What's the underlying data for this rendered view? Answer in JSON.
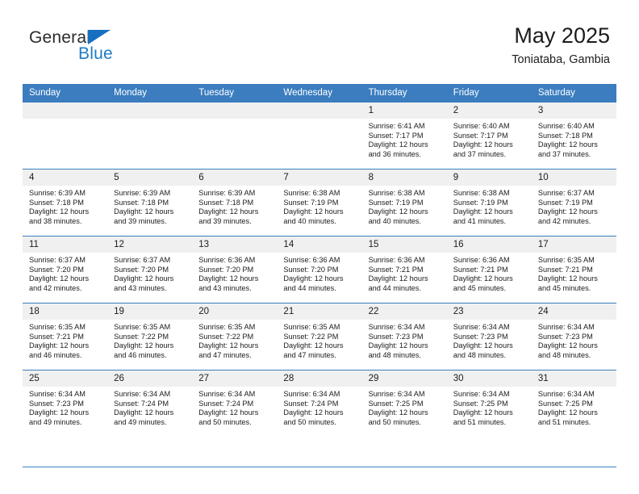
{
  "logo": {
    "word_top": "General",
    "word_bottom": "Blue",
    "triangle_icon": "triangle-icon",
    "accent_color": "#176fc1"
  },
  "header": {
    "title": "May 2025",
    "subtitle": "Toniataba, Gambia"
  },
  "theme": {
    "header_blue": "#3b7dbf",
    "daynum_bg": "#f0f0f0",
    "text": "#1c1c1c"
  },
  "weekday_headers": [
    "Sunday",
    "Monday",
    "Tuesday",
    "Wednesday",
    "Thursday",
    "Friday",
    "Saturday"
  ],
  "weeks": [
    [
      {
        "day": "",
        "empty": true,
        "sunrise": "",
        "sunset": "",
        "daylight_line1": "",
        "daylight_line2": ""
      },
      {
        "day": "",
        "empty": true,
        "sunrise": "",
        "sunset": "",
        "daylight_line1": "",
        "daylight_line2": ""
      },
      {
        "day": "",
        "empty": true,
        "sunrise": "",
        "sunset": "",
        "daylight_line1": "",
        "daylight_line2": ""
      },
      {
        "day": "",
        "empty": true,
        "sunrise": "",
        "sunset": "",
        "daylight_line1": "",
        "daylight_line2": ""
      },
      {
        "day": "1",
        "sunrise": "Sunrise: 6:41 AM",
        "sunset": "Sunset: 7:17 PM",
        "daylight_line1": "Daylight: 12 hours",
        "daylight_line2": "and 36 minutes."
      },
      {
        "day": "2",
        "sunrise": "Sunrise: 6:40 AM",
        "sunset": "Sunset: 7:17 PM",
        "daylight_line1": "Daylight: 12 hours",
        "daylight_line2": "and 37 minutes."
      },
      {
        "day": "3",
        "sunrise": "Sunrise: 6:40 AM",
        "sunset": "Sunset: 7:18 PM",
        "daylight_line1": "Daylight: 12 hours",
        "daylight_line2": "and 37 minutes."
      }
    ],
    [
      {
        "day": "4",
        "sunrise": "Sunrise: 6:39 AM",
        "sunset": "Sunset: 7:18 PM",
        "daylight_line1": "Daylight: 12 hours",
        "daylight_line2": "and 38 minutes."
      },
      {
        "day": "5",
        "sunrise": "Sunrise: 6:39 AM",
        "sunset": "Sunset: 7:18 PM",
        "daylight_line1": "Daylight: 12 hours",
        "daylight_line2": "and 39 minutes."
      },
      {
        "day": "6",
        "sunrise": "Sunrise: 6:39 AM",
        "sunset": "Sunset: 7:18 PM",
        "daylight_line1": "Daylight: 12 hours",
        "daylight_line2": "and 39 minutes."
      },
      {
        "day": "7",
        "sunrise": "Sunrise: 6:38 AM",
        "sunset": "Sunset: 7:19 PM",
        "daylight_line1": "Daylight: 12 hours",
        "daylight_line2": "and 40 minutes."
      },
      {
        "day": "8",
        "sunrise": "Sunrise: 6:38 AM",
        "sunset": "Sunset: 7:19 PM",
        "daylight_line1": "Daylight: 12 hours",
        "daylight_line2": "and 40 minutes."
      },
      {
        "day": "9",
        "sunrise": "Sunrise: 6:38 AM",
        "sunset": "Sunset: 7:19 PM",
        "daylight_line1": "Daylight: 12 hours",
        "daylight_line2": "and 41 minutes."
      },
      {
        "day": "10",
        "sunrise": "Sunrise: 6:37 AM",
        "sunset": "Sunset: 7:19 PM",
        "daylight_line1": "Daylight: 12 hours",
        "daylight_line2": "and 42 minutes."
      }
    ],
    [
      {
        "day": "11",
        "sunrise": "Sunrise: 6:37 AM",
        "sunset": "Sunset: 7:20 PM",
        "daylight_line1": "Daylight: 12 hours",
        "daylight_line2": "and 42 minutes."
      },
      {
        "day": "12",
        "sunrise": "Sunrise: 6:37 AM",
        "sunset": "Sunset: 7:20 PM",
        "daylight_line1": "Daylight: 12 hours",
        "daylight_line2": "and 43 minutes."
      },
      {
        "day": "13",
        "sunrise": "Sunrise: 6:36 AM",
        "sunset": "Sunset: 7:20 PM",
        "daylight_line1": "Daylight: 12 hours",
        "daylight_line2": "and 43 minutes."
      },
      {
        "day": "14",
        "sunrise": "Sunrise: 6:36 AM",
        "sunset": "Sunset: 7:20 PM",
        "daylight_line1": "Daylight: 12 hours",
        "daylight_line2": "and 44 minutes."
      },
      {
        "day": "15",
        "sunrise": "Sunrise: 6:36 AM",
        "sunset": "Sunset: 7:21 PM",
        "daylight_line1": "Daylight: 12 hours",
        "daylight_line2": "and 44 minutes."
      },
      {
        "day": "16",
        "sunrise": "Sunrise: 6:36 AM",
        "sunset": "Sunset: 7:21 PM",
        "daylight_line1": "Daylight: 12 hours",
        "daylight_line2": "and 45 minutes."
      },
      {
        "day": "17",
        "sunrise": "Sunrise: 6:35 AM",
        "sunset": "Sunset: 7:21 PM",
        "daylight_line1": "Daylight: 12 hours",
        "daylight_line2": "and 45 minutes."
      }
    ],
    [
      {
        "day": "18",
        "sunrise": "Sunrise: 6:35 AM",
        "sunset": "Sunset: 7:21 PM",
        "daylight_line1": "Daylight: 12 hours",
        "daylight_line2": "and 46 minutes."
      },
      {
        "day": "19",
        "sunrise": "Sunrise: 6:35 AM",
        "sunset": "Sunset: 7:22 PM",
        "daylight_line1": "Daylight: 12 hours",
        "daylight_line2": "and 46 minutes."
      },
      {
        "day": "20",
        "sunrise": "Sunrise: 6:35 AM",
        "sunset": "Sunset: 7:22 PM",
        "daylight_line1": "Daylight: 12 hours",
        "daylight_line2": "and 47 minutes."
      },
      {
        "day": "21",
        "sunrise": "Sunrise: 6:35 AM",
        "sunset": "Sunset: 7:22 PM",
        "daylight_line1": "Daylight: 12 hours",
        "daylight_line2": "and 47 minutes."
      },
      {
        "day": "22",
        "sunrise": "Sunrise: 6:34 AM",
        "sunset": "Sunset: 7:23 PM",
        "daylight_line1": "Daylight: 12 hours",
        "daylight_line2": "and 48 minutes."
      },
      {
        "day": "23",
        "sunrise": "Sunrise: 6:34 AM",
        "sunset": "Sunset: 7:23 PM",
        "daylight_line1": "Daylight: 12 hours",
        "daylight_line2": "and 48 minutes."
      },
      {
        "day": "24",
        "sunrise": "Sunrise: 6:34 AM",
        "sunset": "Sunset: 7:23 PM",
        "daylight_line1": "Daylight: 12 hours",
        "daylight_line2": "and 48 minutes."
      }
    ],
    [
      {
        "day": "25",
        "sunrise": "Sunrise: 6:34 AM",
        "sunset": "Sunset: 7:23 PM",
        "daylight_line1": "Daylight: 12 hours",
        "daylight_line2": "and 49 minutes."
      },
      {
        "day": "26",
        "sunrise": "Sunrise: 6:34 AM",
        "sunset": "Sunset: 7:24 PM",
        "daylight_line1": "Daylight: 12 hours",
        "daylight_line2": "and 49 minutes."
      },
      {
        "day": "27",
        "sunrise": "Sunrise: 6:34 AM",
        "sunset": "Sunset: 7:24 PM",
        "daylight_line1": "Daylight: 12 hours",
        "daylight_line2": "and 50 minutes."
      },
      {
        "day": "28",
        "sunrise": "Sunrise: 6:34 AM",
        "sunset": "Sunset: 7:24 PM",
        "daylight_line1": "Daylight: 12 hours",
        "daylight_line2": "and 50 minutes."
      },
      {
        "day": "29",
        "sunrise": "Sunrise: 6:34 AM",
        "sunset": "Sunset: 7:25 PM",
        "daylight_line1": "Daylight: 12 hours",
        "daylight_line2": "and 50 minutes."
      },
      {
        "day": "30",
        "sunrise": "Sunrise: 6:34 AM",
        "sunset": "Sunset: 7:25 PM",
        "daylight_line1": "Daylight: 12 hours",
        "daylight_line2": "and 51 minutes."
      },
      {
        "day": "31",
        "sunrise": "Sunrise: 6:34 AM",
        "sunset": "Sunset: 7:25 PM",
        "daylight_line1": "Daylight: 12 hours",
        "daylight_line2": "and 51 minutes."
      }
    ]
  ]
}
